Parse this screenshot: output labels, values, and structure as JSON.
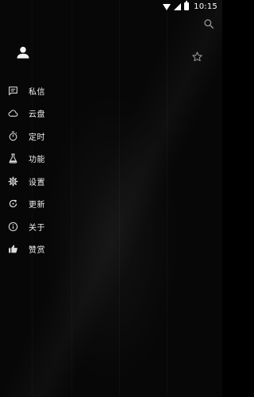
{
  "status_bar": {
    "time": "10:15",
    "icons": [
      "wifi-icon",
      "signal-off-icon",
      "battery-icon"
    ]
  },
  "toolbar": {
    "search_icon": "search-icon"
  },
  "drawer": {
    "avatar_icon": "person-icon",
    "favorite_icon": "star-outline-icon",
    "items": [
      {
        "label": "私信",
        "icon": "message-icon"
      },
      {
        "label": "云盘",
        "icon": "cloud-icon"
      },
      {
        "label": "定时",
        "icon": "timer-icon"
      },
      {
        "label": "功能",
        "icon": "flask-icon"
      },
      {
        "label": "设置",
        "icon": "gear-icon"
      },
      {
        "label": "更新",
        "icon": "refresh-icon"
      },
      {
        "label": "关于",
        "icon": "info-icon"
      },
      {
        "label": "赞赏",
        "icon": "thumb-up-icon"
      }
    ]
  },
  "colors": {
    "background": "#050505",
    "text": "#f0f0f0",
    "icon": "#dcdcdc"
  }
}
